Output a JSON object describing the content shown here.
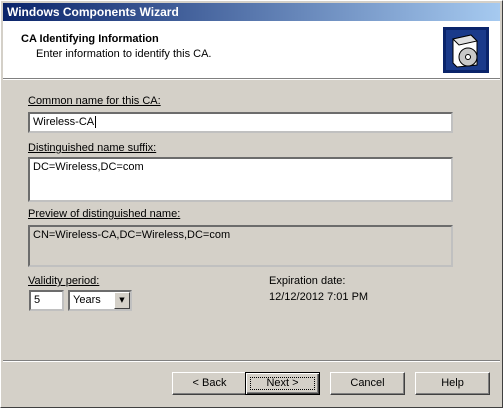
{
  "window": {
    "title": "Windows Components Wizard"
  },
  "header": {
    "title": "CA Identifying Information",
    "subtitle": "Enter information to identify this CA.",
    "icon": "cd-box-icon"
  },
  "form": {
    "common_name": {
      "label": "Common name for this CA:",
      "value": "Wireless-CA"
    },
    "dn_suffix": {
      "label": "Distinguished name suffix:",
      "value": "DC=Wireless,DC=com"
    },
    "preview": {
      "label": "Preview of distinguished name:",
      "value": "CN=Wireless-CA,DC=Wireless,DC=com"
    },
    "validity": {
      "label": "Validity period:",
      "value": "5",
      "unit": "Years"
    },
    "expiration": {
      "label": "Expiration date:",
      "value": "12/12/2012 7:01 PM"
    }
  },
  "buttons": {
    "back": "< Back",
    "next": "Next >",
    "cancel": "Cancel",
    "help": "Help"
  }
}
